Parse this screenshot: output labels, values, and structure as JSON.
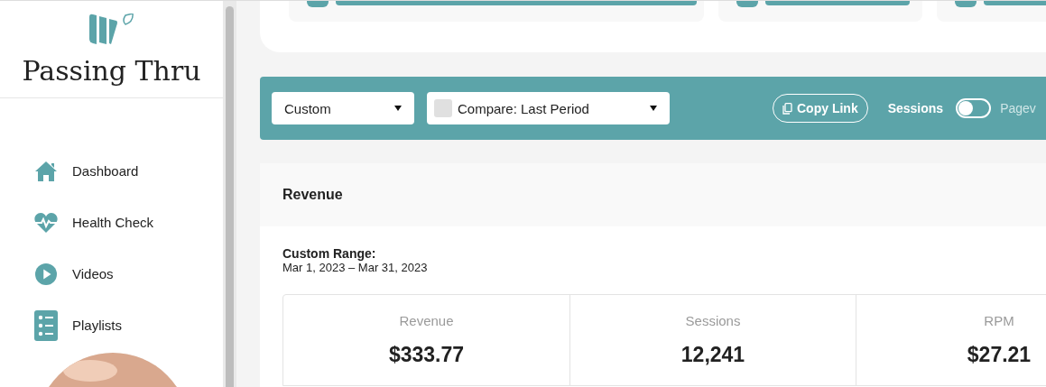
{
  "sidebar": {
    "brand": "Passing Thru",
    "items": [
      {
        "label": "Dashboard",
        "kind": "home"
      },
      {
        "label": "Health Check",
        "kind": "heart"
      },
      {
        "label": "Videos",
        "kind": "play"
      },
      {
        "label": "Playlists",
        "kind": "list"
      }
    ]
  },
  "filter_bar": {
    "range_select": "Custom",
    "compare_select": {
      "label": "Compare: Last Period",
      "checked": false
    },
    "copy_link": "Copy Link",
    "toggle": {
      "label": "Sessions",
      "on": false
    },
    "next_label": "Pagev"
  },
  "revenue": {
    "title": "Revenue",
    "range_label": "Custom Range:",
    "range_dates": "Mar 1, 2023 – Mar 31, 2023",
    "metrics": [
      {
        "label": "Revenue",
        "value": "$333.77"
      },
      {
        "label": "Sessions",
        "value": "12,241"
      },
      {
        "label": "RPM",
        "value": "$27.21"
      }
    ]
  }
}
